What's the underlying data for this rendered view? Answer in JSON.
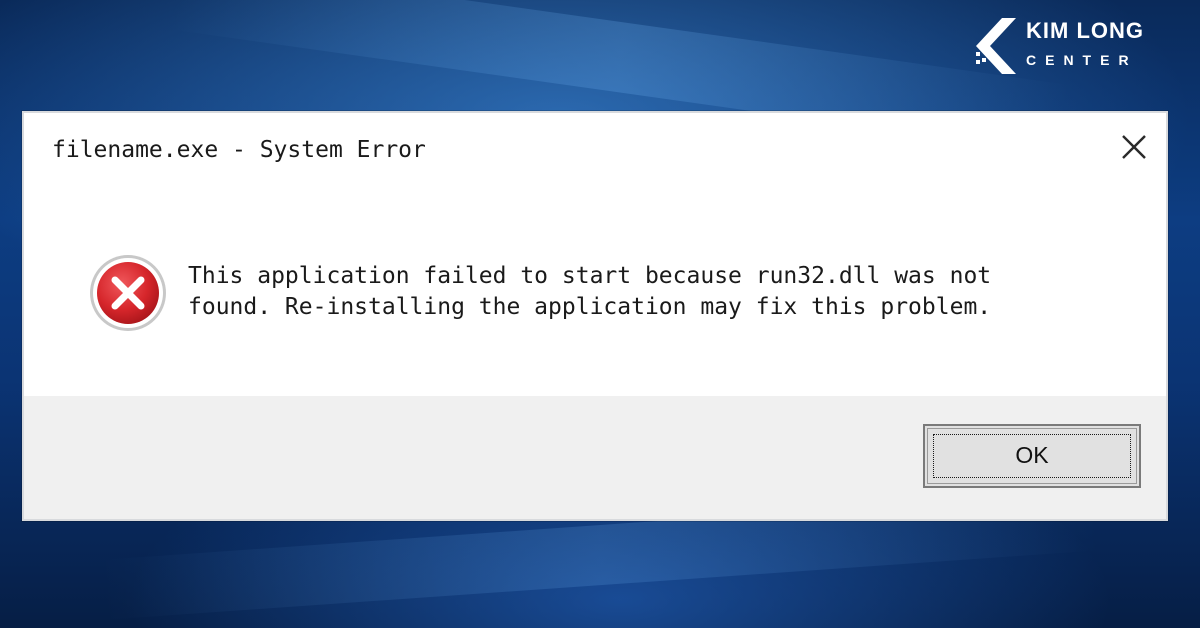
{
  "logo": {
    "title": "KIM LONG",
    "subtitle": "CENTER",
    "mark_icon": "chevron-k-logo-icon"
  },
  "dialog": {
    "title": "filename.exe - System Error",
    "close_icon": "close-icon",
    "error_icon": "error-x-circle-icon",
    "message_line_1": "This application failed to start because run32.dll was not",
    "message_line_2": "found. Re-installing the application may fix this problem.",
    "ok_label": "OK"
  },
  "colors": {
    "wallpaper": "#0d3d82",
    "dialog_bg": "#ffffff",
    "footer_bg": "#f0f0f0",
    "error_red": "#d6262b",
    "button_bg": "#e1e1e1"
  }
}
